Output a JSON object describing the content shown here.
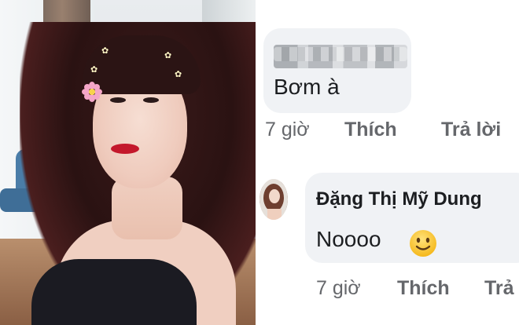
{
  "comment_1": {
    "text": "Bơm à",
    "time": "7 giờ",
    "like": "Thích",
    "reply": "Trả lời"
  },
  "comment_2": {
    "author": "Đặng Thị Mỹ Dung",
    "text": "Noooo",
    "emoji_icon": "slightly-smiling-face",
    "time": "7 giờ",
    "like": "Thích",
    "reply": "Trả"
  },
  "colors": {
    "bubble": "#f0f2f5",
    "meta_text": "#65676b",
    "primary_text": "#1c1e21",
    "lipstick": "#c4182c"
  }
}
